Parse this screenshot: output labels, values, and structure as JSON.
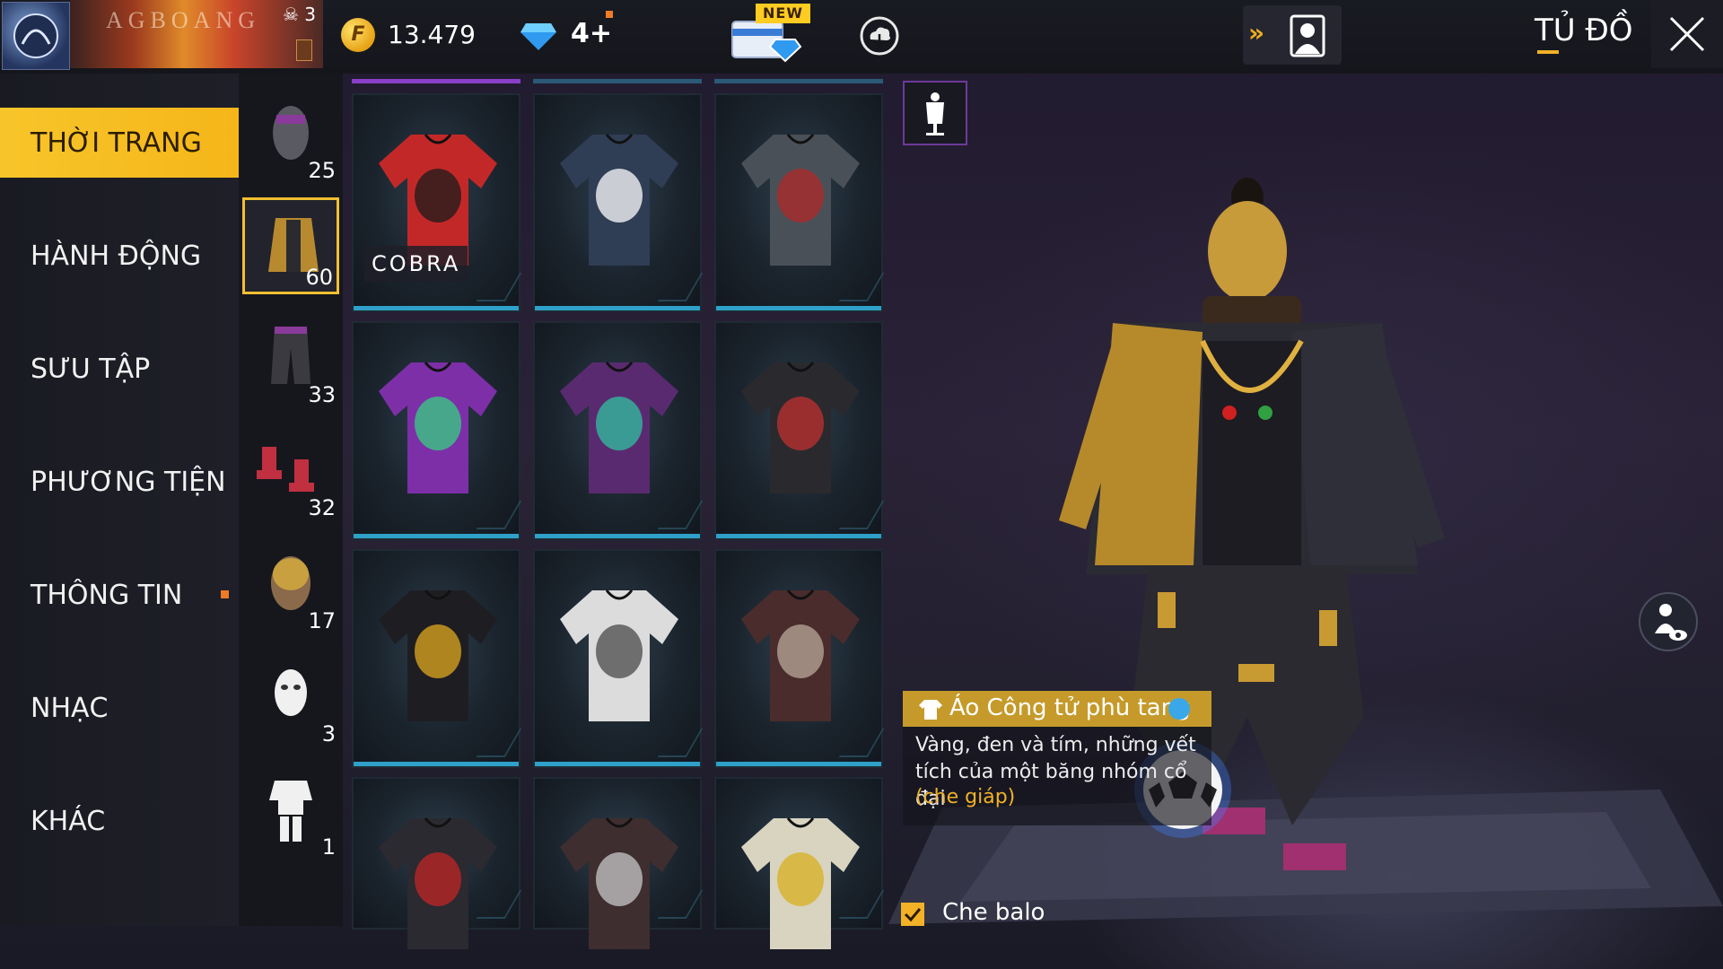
{
  "header": {
    "player_name": "AGBOANG",
    "rank_count": "3",
    "gold_amount": "13.479",
    "coin_symbol": "F",
    "diamond_amount": "4+",
    "new_badge": "NEW",
    "page_title": "TỦ ĐỒ"
  },
  "sidebar": {
    "categories": [
      {
        "label": "THỜI TRANG",
        "active": true
      },
      {
        "label": "HÀNH ĐỘNG"
      },
      {
        "label": "SƯU TẬP"
      },
      {
        "label": "PHƯƠNG TIỆN"
      },
      {
        "label": "THÔNG TIN",
        "notification": true
      },
      {
        "label": "NHẠC"
      },
      {
        "label": "KHÁC"
      }
    ]
  },
  "subcategories": [
    {
      "icon": "head-icon",
      "count": "25"
    },
    {
      "icon": "top-icon",
      "count": "60",
      "active": true
    },
    {
      "icon": "pants-icon",
      "count": "33"
    },
    {
      "icon": "shoes-icon",
      "count": "32"
    },
    {
      "icon": "mask-icon",
      "count": "17"
    },
    {
      "icon": "face-icon",
      "count": "3"
    },
    {
      "icon": "outfit-icon",
      "count": "1"
    }
  ],
  "items": [
    {
      "name": "red-black-jacket",
      "color": "#c32828",
      "accent": "#1b1b1b",
      "badge": "COBRA"
    },
    {
      "name": "dark-blue-tee",
      "color": "#2f3d55",
      "accent": "#ffffff"
    },
    {
      "name": "dark-vest",
      "color": "#4a5058",
      "accent": "#b02828"
    },
    {
      "name": "purple-green-tee",
      "color": "#7d2fa8",
      "accent": "#35d080"
    },
    {
      "name": "purple-hoodie-vest",
      "color": "#5a2a70",
      "accent": "#30c0a0"
    },
    {
      "name": "dark-red-tee",
      "color": "#2a2a2e",
      "accent": "#c03030"
    },
    {
      "name": "gold-black-tee",
      "color": "#1e1e22",
      "accent": "#e0a820"
    },
    {
      "name": "white-tiger-tee",
      "color": "#dcdcdc",
      "accent": "#4a4a4a"
    },
    {
      "name": "brown-skull-tee",
      "color": "#4a2c2c",
      "accent": "#b9a89a"
    },
    {
      "name": "red-scarf-jacket",
      "color": "#2a2a30",
      "accent": "#c02626"
    },
    {
      "name": "brown-graphic-tee",
      "color": "#3e2e30",
      "accent": "#c8c8c8"
    },
    {
      "name": "hip-hop-vest",
      "color": "#d8d4c0",
      "accent": "#d8b020"
    }
  ],
  "selected_item": {
    "title": "Áo Công tử phù tang",
    "description": "Vàng, đen và tím, những vết tích của một băng nhóm cổ đại",
    "tag": "(che giáp)"
  },
  "options": {
    "hide_backpack_label": "Che balo",
    "hide_backpack_checked": true
  },
  "colors": {
    "accent_gold": "#f2b126",
    "item_bar": "#2fa0c8",
    "tab_purple": "#8a3fc8"
  }
}
